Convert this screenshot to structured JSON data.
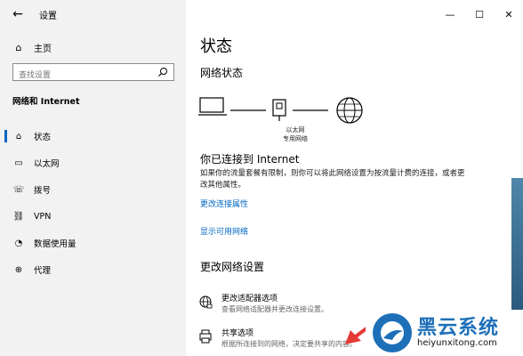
{
  "window": {
    "app_title": "设置",
    "controls": {
      "minimize": "—",
      "maximize": "☐",
      "close": "✕"
    }
  },
  "sidebar": {
    "home_label": "主页",
    "search_placeholder": "查找设置",
    "section_title": "网络和 Internet",
    "items": [
      {
        "label": "状态",
        "icon": "status-icon",
        "active": true
      },
      {
        "label": "以太网",
        "icon": "ethernet-icon"
      },
      {
        "label": "拨号",
        "icon": "dialup-icon"
      },
      {
        "label": "VPN",
        "icon": "vpn-icon"
      },
      {
        "label": "数据使用量",
        "icon": "data-usage-icon"
      },
      {
        "label": "代理",
        "icon": "proxy-icon"
      }
    ]
  },
  "main": {
    "page_title": "状态",
    "network_status": "网络状态",
    "diagram_label_line1": "以太网",
    "diagram_label_line2": "专用网络",
    "connected_title": "你已连接到 Internet",
    "description": "如果你的流量套餐有限制，则你可以将此网络设置为按流量计费的连接，或者更改其他属性。",
    "link_change_props": "更改连接属性",
    "link_show_networks": "显示可用网络",
    "change_settings_title": "更改网络设置",
    "options": [
      {
        "title": "更改适配器选项",
        "desc": "查看网络适配器并更改连接设置。"
      },
      {
        "title": "共享选项",
        "desc": "根据所连接到的网络，决定要共享的内容。"
      }
    ]
  },
  "watermark": {
    "title": "黑云系统",
    "url": "heiyunxitong.com"
  },
  "colors": {
    "accent": "#0067c0",
    "watermark_blue": "#1d6fb8",
    "arrow_red": "#e53935"
  }
}
